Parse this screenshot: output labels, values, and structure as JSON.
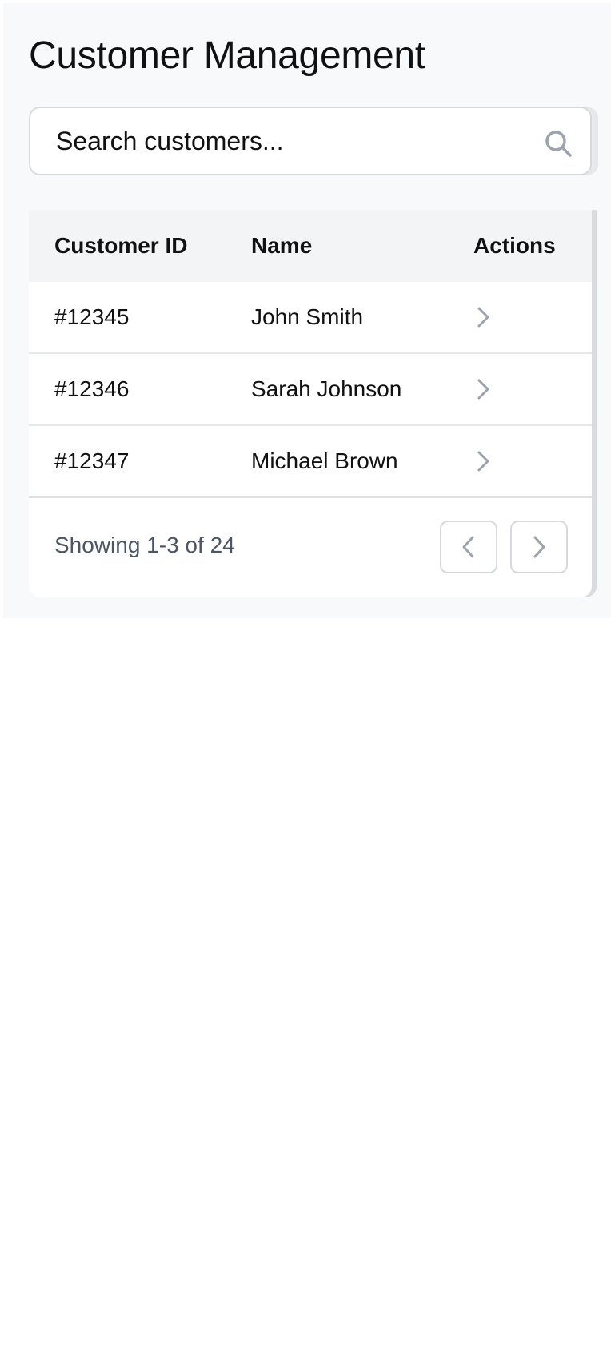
{
  "page": {
    "title": "Customer Management"
  },
  "search": {
    "placeholder": "Search customers...",
    "icon": "search-icon"
  },
  "table": {
    "columns": [
      "Customer ID",
      "Name",
      "Actions"
    ],
    "rows": [
      {
        "id": "#12345",
        "name": "John Smith",
        "action_icon": "chevron-right-icon"
      },
      {
        "id": "#12346",
        "name": "Sarah Johnson",
        "action_icon": "chevron-right-icon"
      },
      {
        "id": "#12347",
        "name": "Michael Brown",
        "action_icon": "chevron-right-icon"
      }
    ]
  },
  "pagination": {
    "summary": "Showing 1-3 of 24",
    "prev_icon": "chevron-left-icon",
    "next_icon": "chevron-right-icon"
  },
  "colors": {
    "panel_background": "#f8f9fb",
    "header_background": "#f3f4f6",
    "border": "#d6d9de",
    "muted_text": "#4b5563",
    "icon_gray": "#9ca3af"
  }
}
